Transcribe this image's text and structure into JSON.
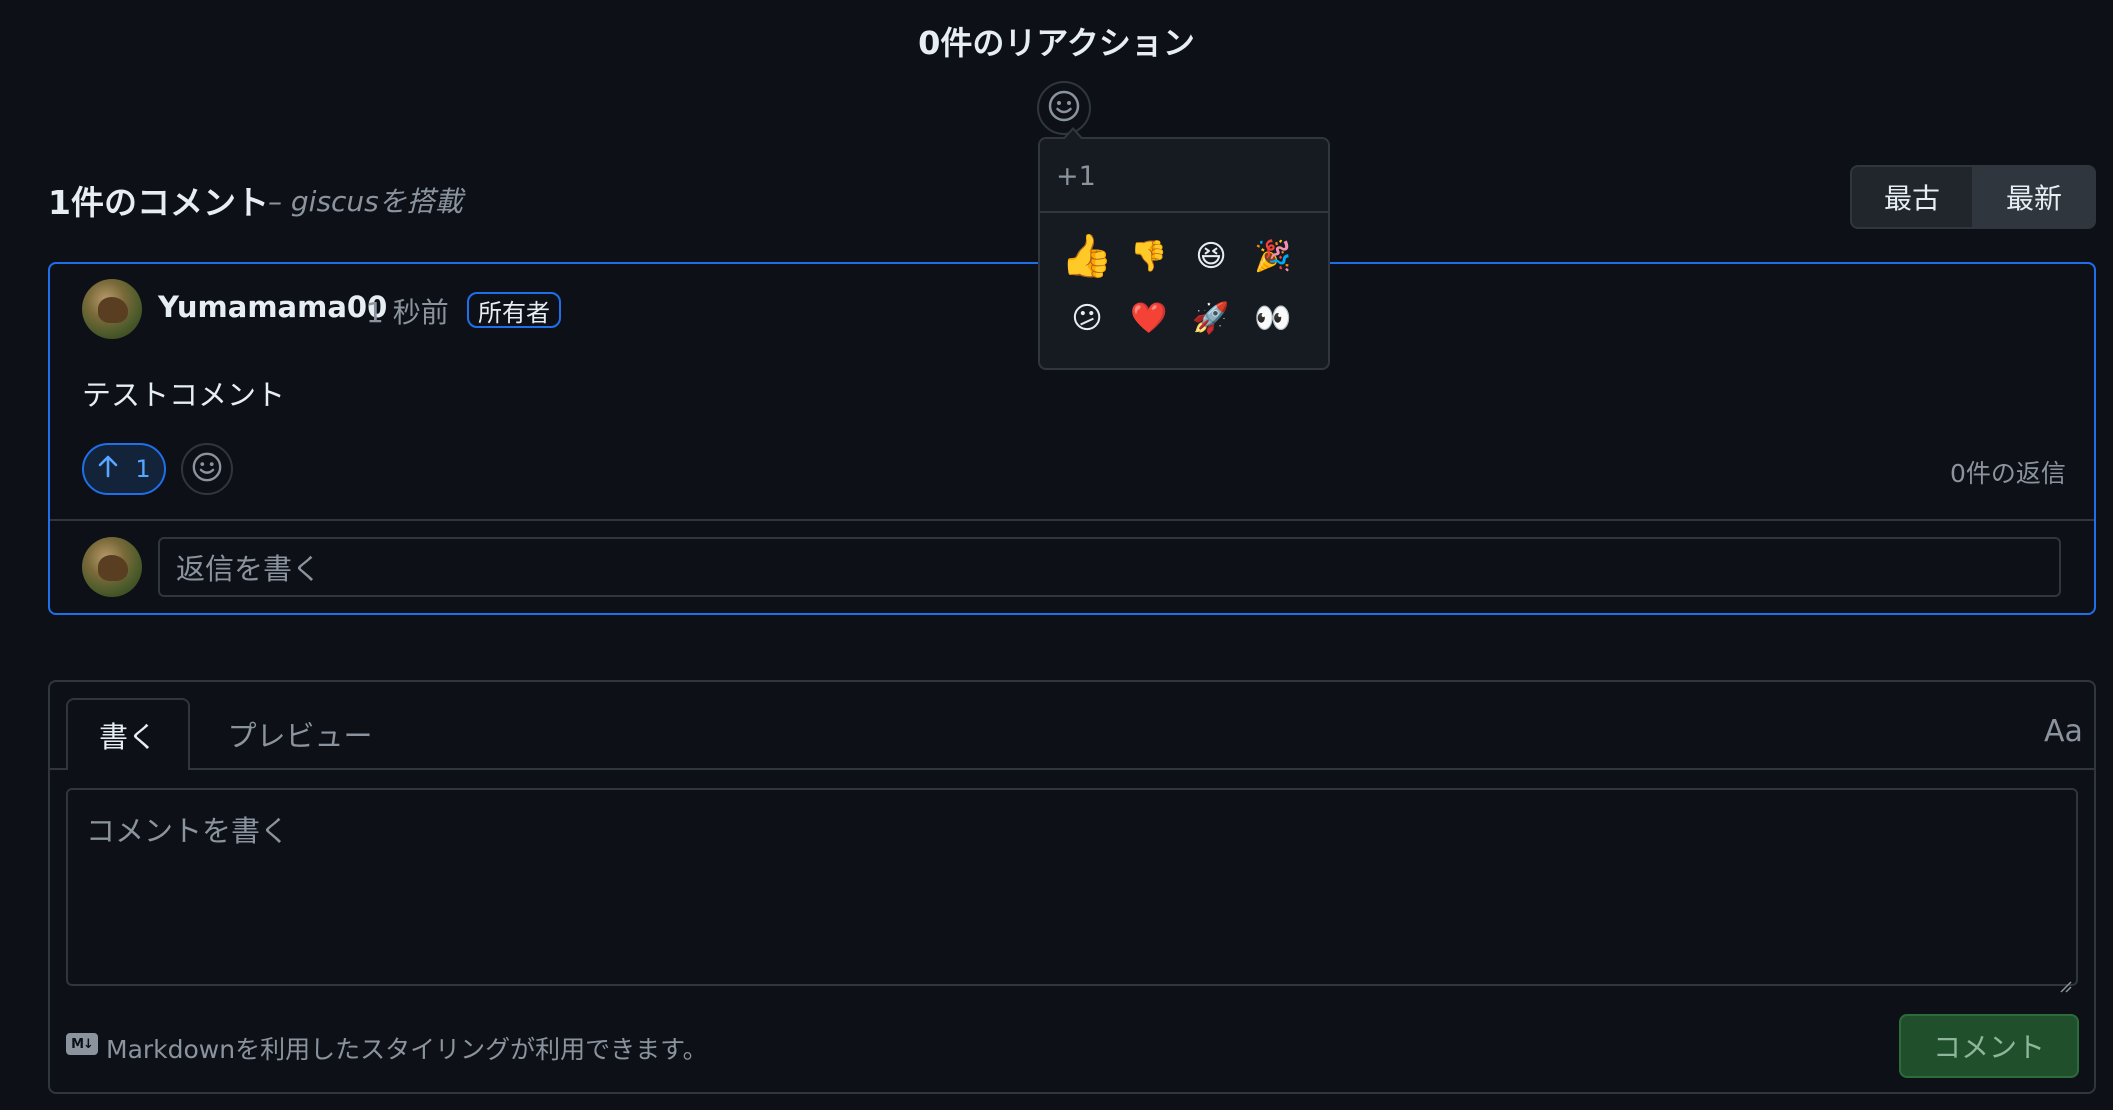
{
  "reactions": {
    "title": "0件のリアクション",
    "add_reaction_icon": "smiley-icon"
  },
  "emoji_picker": {
    "label": "+1",
    "emojis": [
      {
        "name": "thumbs-up",
        "glyph": "👍"
      },
      {
        "name": "thumbs-down",
        "glyph": "👎"
      },
      {
        "name": "laugh",
        "glyph": "😆"
      },
      {
        "name": "hooray",
        "glyph": "🎉"
      },
      {
        "name": "confused",
        "glyph": "😕"
      },
      {
        "name": "heart",
        "glyph": "❤️"
      },
      {
        "name": "rocket",
        "glyph": "🚀"
      },
      {
        "name": "eyes",
        "glyph": "👀"
      }
    ]
  },
  "comments_header": {
    "title": "1件のコメント",
    "powered_by": "– giscusを搭載"
  },
  "sort": {
    "oldest": "最古",
    "newest": "最新",
    "selected": "newest"
  },
  "comment": {
    "author": "Yumamama00",
    "time": "1 秒前",
    "badge": "所有者",
    "body": "テストコメント",
    "upvote_count": "1",
    "upvote_icon": "arrow-up-icon",
    "replies": "0件の返信",
    "reply_placeholder": "返信を書く"
  },
  "editor": {
    "tab_write": "書く",
    "tab_preview": "プレビュー",
    "format_toggle": "Aa",
    "placeholder": "コメントを書く",
    "markdown_icon": "markdown-icon",
    "markdown_hint": "Markdownを利用したスタイリングが利用できます。",
    "submit": "コメント"
  },
  "colors": {
    "background": "#0d1117",
    "border": "#30363d",
    "accent": "#1f6feb",
    "muted_text": "#8b949e",
    "submit_bg": "#1f4f2b"
  }
}
